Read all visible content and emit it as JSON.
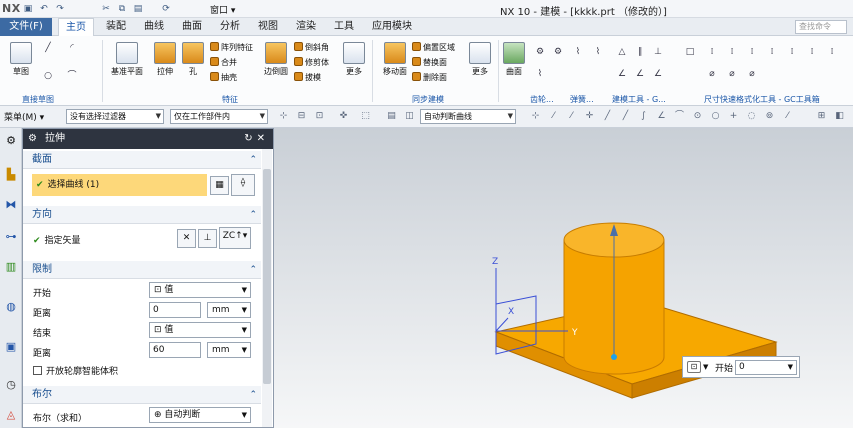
{
  "titlebar": {
    "logo": "NX",
    "title": "NX 10 - 建模 - [kkkk.prt （修改的）]",
    "window_menu": "窗口 ▾"
  },
  "tabs": [
    {
      "label": "文件(F)"
    },
    {
      "label": "主页"
    },
    {
      "label": "装配"
    },
    {
      "label": "曲线"
    },
    {
      "label": "曲面"
    },
    {
      "label": "分析"
    },
    {
      "label": "视图"
    },
    {
      "label": "渲染"
    },
    {
      "label": "工具"
    },
    {
      "label": "应用模块"
    }
  ],
  "search_placeholder": "查找命令",
  "ribbon": {
    "sketch": "草图",
    "datum_plane": "基准平面",
    "extrude": "拉伸",
    "hole": "孔",
    "pattern_feature": "阵列特征",
    "combine": "合并",
    "shell": "抽壳",
    "edge_blend": "边倒圆",
    "chamfer": "倒斜角",
    "trim_body": "修剪体",
    "draft": "拔模",
    "more1": "更多",
    "move_face": "移动面",
    "offset_region": "偏置区域",
    "replace_face": "替换面",
    "delete_face": "删除面",
    "more2": "更多",
    "surface": "曲面",
    "group_direct_sketch": "直接草图",
    "group_feature": "特征",
    "group_sync": "同步建模",
    "group_curve": "齿轮...",
    "group_spring": "弹簧...",
    "group_gc": "建模工具 - G...",
    "group_dim": "尺寸快速格式化工具 - GC工具箱"
  },
  "selbar": {
    "menu": "菜单(M) ▾",
    "filter": "没有选择过滤器",
    "scope": "仅在工作部件内",
    "curve_rule": "自动判断曲线"
  },
  "dialog": {
    "title": "拉伸",
    "sec_section": "截面",
    "select_curve": "选择曲线 (1)",
    "sec_direction": "方向",
    "specify_vector": "指定矢量",
    "sec_limits": "限制",
    "start_label": "开始",
    "start_value": "值",
    "start_dist_label": "距离",
    "start_dist": "0",
    "start_unit": "mm",
    "end_label": "结束",
    "end_value": "值",
    "end_dist_label": "距离",
    "end_dist": "60",
    "end_unit": "mm",
    "open_profile": "开放轮廓智能体积",
    "sec_boolean": "布尔",
    "boolean_label": "布尔（求和）",
    "boolean_value": "自动判断"
  },
  "viewport": {
    "axis_z": "Z",
    "axis_y": "Y",
    "axis_x": "X",
    "start_label": "开始",
    "start_value": "0",
    "body_color": "#f5a300",
    "body_edge": "#c77d00"
  }
}
